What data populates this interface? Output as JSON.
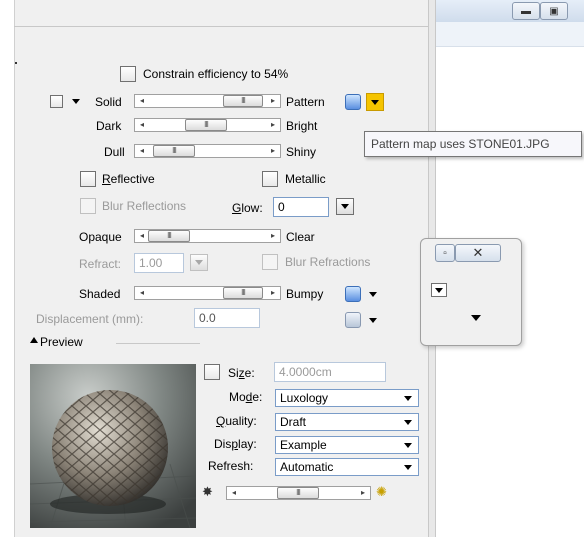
{
  "constrain": {
    "label": "Constrain efficiency to 54%",
    "checked": false
  },
  "rows": {
    "solid_pattern": {
      "left": "Solid",
      "right": "Pattern",
      "value": 0.82
    },
    "dark_bright": {
      "left": "Dark",
      "right": "Bright",
      "value": 0.45
    },
    "dull_shiny": {
      "left": "Dull",
      "right": "Shiny",
      "value": 0.12
    },
    "opaque_clear": {
      "left": "Opaque",
      "right": "Clear",
      "value": 0.08
    },
    "shaded_bumpy": {
      "left": "Shaded",
      "right": "Bumpy",
      "value": 0.82
    }
  },
  "tooltip": "Pattern map uses STONE01.JPG",
  "reflective": {
    "label_first": "R",
    "label_rest": "eflective"
  },
  "metallic": {
    "label": "Metallic"
  },
  "blur_reflections": {
    "label": "Blur Reflections"
  },
  "glow": {
    "label_first": "G",
    "label_rest": "low:",
    "value": "0"
  },
  "refract": {
    "label": "Refract:",
    "value": "1.00"
  },
  "blur_refractions": {
    "label": "Blur Refractions"
  },
  "displacement": {
    "label": "Displacement (mm):",
    "value": "0.0"
  },
  "preview": {
    "section_label": "Preview",
    "size": {
      "label_pre": "Si",
      "label_u": "z",
      "label_post": "e:",
      "value": "4.0000cm"
    },
    "mode": {
      "label_pre": "Mo",
      "label_u": "d",
      "label_post": "e:",
      "value": "Luxology"
    },
    "quality": {
      "label_u": "Q",
      "label_post": "uality:",
      "value": "Draft"
    },
    "display": {
      "label_pre": "Dis",
      "label_u": "p",
      "label_post": "lay:",
      "value": "Example"
    },
    "refresh": {
      "label": "Refresh:",
      "value": "Automatic"
    },
    "light_slider": 0.45
  },
  "colors": {
    "panel": "#f0f0f0",
    "field_border": "#7a9cc8",
    "accent": "#f5c400"
  }
}
